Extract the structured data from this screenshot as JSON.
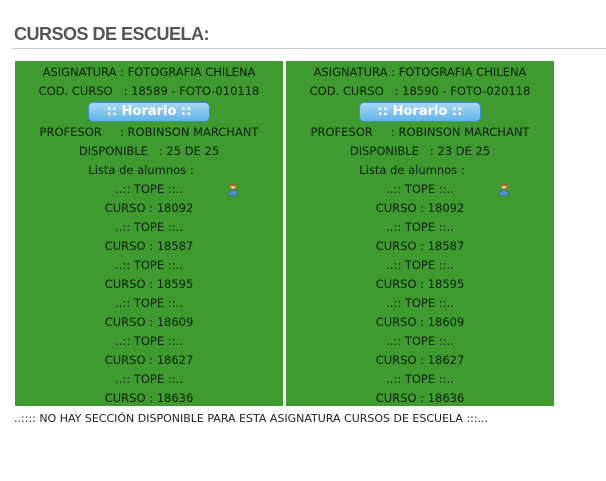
{
  "page": {
    "title": "CURSOS DE ESCUELA:"
  },
  "cards": [
    {
      "subject": "ASIGNATURA : FOTOGRAFIA CHILENA",
      "code": "COD. CURSO   : 18589 - FOTO-010118",
      "schedule_label": "::  Horario  ::",
      "teacher": "PROFESOR     : ROBINSON MARCHANT",
      "available": "DISPONIBLE   : 25 DE 25",
      "students_label": "Lista de alumnos :",
      "tope_label": "..:: TOPE ::..",
      "topes": [
        "CURSO : 18092",
        "CURSO : 18587",
        "CURSO : 18595",
        "CURSO : 18609",
        "CURSO : 18627",
        "CURSO : 18636"
      ]
    },
    {
      "subject": "ASIGNATURA : FOTOGRAFIA CHILENA",
      "code": "COD. CURSO   : 18590 - FOTO-020118",
      "schedule_label": "::  Horario  ::",
      "teacher": "PROFESOR     : ROBINSON MARCHANT",
      "available": "DISPONIBLE   : 23 DE 25",
      "students_label": "Lista de alumnos :",
      "tope_label": "..:: TOPE ::..",
      "topes": [
        "CURSO : 18092",
        "CURSO : 18587",
        "CURSO : 18595",
        "CURSO : 18609",
        "CURSO : 18627",
        "CURSO : 18636"
      ]
    }
  ],
  "footer": {
    "message": "..:::: NO HAY SECCIÓN DISPONIBLE PARA ESTA ASIGNATURA CURSOS DE ESCUELA :::..."
  },
  "icons": {
    "students": "person-icon"
  },
  "colors": {
    "card_bg": "#3f9b2f",
    "button": "#62b3e9"
  }
}
